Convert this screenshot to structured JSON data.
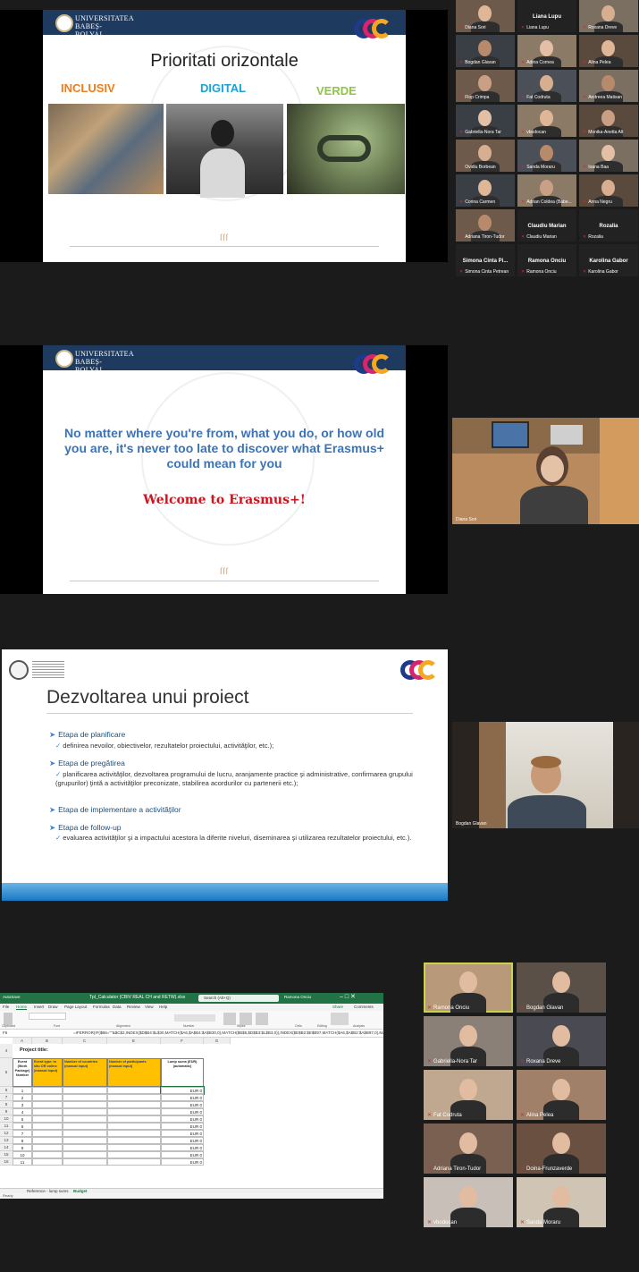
{
  "slide1": {
    "university": "UNIVERSITATEA BABEȘ-BOLYAI",
    "title": "Prioritati orizontale",
    "priorities": [
      {
        "label": "INCLUSIV",
        "color": "#f07d1a"
      },
      {
        "label": "DIGITAL",
        "color": "#1aa3d9"
      },
      {
        "label": "VERDE",
        "color": "#8dc63f"
      }
    ]
  },
  "slide2": {
    "university": "UNIVERSITATEA BABEȘ-BOLYAI",
    "quote": "No matter where you're from, what you do, or how old you are, it's never too late to discover what Erasmus+ could mean for you",
    "welcome": "Welcome to Erasmus+!"
  },
  "slide3": {
    "title": "Dezvoltarea unui proiect",
    "stages": [
      {
        "heading": "Etapa de planificare",
        "detail": "definirea nevoilor, obiectivelor, rezultatelor proiectului, activităţilor, etc.);"
      },
      {
        "heading": "Etapa de pregătirea",
        "detail": "planificarea activităţilor, dezvoltarea programului de lucru, aranjamente practice şi administrative, confirmarea grupului (grupurilor) ţintă a activităţilor preconizate, stabilirea acordurilor cu partenerii etc.);"
      },
      {
        "heading": "Etapa de implementare a activităţilor",
        "detail": ""
      },
      {
        "heading": "Etapa de follow-up",
        "detail": "evaluarea activităţilor şi a impactului acestora la diferite niveluri, diseminarea şi utilizarea rezultatelor proiectului, etc.)."
      }
    ]
  },
  "gallery1": [
    {
      "name": "Diana Sori",
      "center": ""
    },
    {
      "name": "Liana Lupu",
      "center": "Liana Lupu"
    },
    {
      "name": "Roxana Dreve",
      "center": ""
    },
    {
      "name": "Bogdan Glavan",
      "center": ""
    },
    {
      "name": "Adina Cornea",
      "center": ""
    },
    {
      "name": "Alina Pelea",
      "center": ""
    },
    {
      "name": "Flop Crimpa",
      "center": ""
    },
    {
      "name": "Fat Codruta",
      "center": ""
    },
    {
      "name": "Andreea Matisan",
      "center": ""
    },
    {
      "name": "Gabriella-Nora Tar",
      "center": ""
    },
    {
      "name": "vbodocan",
      "center": ""
    },
    {
      "name": "Monika-Anetta Alt",
      "center": ""
    },
    {
      "name": "Ovidiu Borbean",
      "center": ""
    },
    {
      "name": "Sanda Moraru",
      "center": ""
    },
    {
      "name": "Ioana Baa",
      "center": ""
    },
    {
      "name": "Corina Carmen",
      "center": ""
    },
    {
      "name": "Adrian Coldea (Babe...",
      "center": ""
    },
    {
      "name": "Anna Negru",
      "center": ""
    },
    {
      "name": "Adriana Tiron-Tudor",
      "center": ""
    },
    {
      "name": "Claudiu Marian",
      "center": "Claudiu Marian"
    },
    {
      "name": "Rozalia",
      "center": "Rozalia"
    },
    {
      "name": "Simona Cinta Petrean",
      "center": "Simona Cinta Pi..."
    },
    {
      "name": "Ramona Onciu",
      "center": "Ramona Onciu"
    },
    {
      "name": "Karolina Gabor",
      "center": "Karolina Gabor"
    }
  ],
  "speaker2": {
    "name": "Diana Sori"
  },
  "speaker3": {
    "name": "Bogdan Glavan"
  },
  "excel": {
    "autosave": "AutoSave",
    "file_title": "Tpl_Calculator (CBIV REAL CH and RETW).xlsx",
    "search": "Search (Alt+Q)",
    "user": "Ramona Onciu",
    "menu": [
      "File",
      "Home",
      "Insert",
      "Draw",
      "Page Layout",
      "Formulas",
      "Data",
      "Review",
      "View",
      "Help"
    ],
    "share": "Share",
    "comments": "Comments",
    "ribbon_groups": [
      "Clipboard",
      "Font",
      "Alignment",
      "Number",
      "Styles",
      "Cells",
      "Editing",
      "Analysis"
    ],
    "cell_ref": "F6",
    "formula": "=IFERROR(IF($B6=\"\"&$C$2,INDEX($D$B4:$L$30,MATCH($A6,$A$B4:$A$B30,0),MATCH($B$5,$D$B3:$L$B3,0)),INDEX($E$B2:$E$B97,MATCH($A6,$A$B2:$A$B97,0),MATCH($B$5,...",
    "columns": [
      "A",
      "B",
      "C",
      "E",
      "F",
      "G"
    ],
    "project_title": "Project title:",
    "headers": [
      "Event (Work Package) Number",
      "Event type: In situ OR online (manual input)",
      "Number of countries (manual input)",
      "Number of participants (manual input)",
      "Lump sums (EUR) (automatic)"
    ],
    "rows": [
      "1",
      "2",
      "3",
      "4",
      "5",
      "6",
      "7",
      "8",
      "9",
      "10",
      "11"
    ],
    "row_numbers": [
      "4",
      "5",
      "6",
      "7",
      "8",
      "9",
      "10",
      "11",
      "12",
      "13",
      "14",
      "15",
      "16"
    ],
    "lump_value": "EUR 0",
    "tabs": [
      "Reference - lump sums",
      "Budget"
    ],
    "status": "Ready"
  },
  "gallery4": [
    {
      "name": "Ramona Onciu",
      "speaker": true
    },
    {
      "name": "Bogdan Glavan",
      "speaker": false
    },
    {
      "name": "Gabriella-Nora Tar",
      "speaker": false
    },
    {
      "name": "Roxana Dreve",
      "speaker": false
    },
    {
      "name": "Fat Codruta",
      "speaker": false
    },
    {
      "name": "Alina Pelea",
      "speaker": false
    },
    {
      "name": "Adriana Tiron-Tudor",
      "speaker": false
    },
    {
      "name": "Doina-Frunzaverde",
      "speaker": false
    },
    {
      "name": "vbodocan",
      "speaker": false
    },
    {
      "name": "Sanda Moraru",
      "speaker": false
    }
  ]
}
